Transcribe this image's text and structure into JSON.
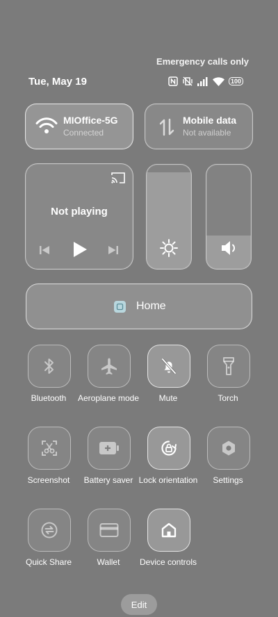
{
  "status_bar": {
    "emergency_text": "Emergency calls only",
    "date": "Tue, May 19",
    "battery_level": "100",
    "icons": [
      "nfc-icon",
      "vibrate-off-icon",
      "signal-icon",
      "wifi-icon",
      "battery-icon"
    ]
  },
  "wifi_tile": {
    "title": "MIOffice-5G",
    "subtitle": "Connected",
    "icon": "wifi-icon"
  },
  "mobile_tile": {
    "title": "Mobile data",
    "subtitle": "Not available",
    "icon": "data-arrows-icon"
  },
  "media": {
    "status": "Not playing",
    "controls": [
      "previous-icon",
      "play-icon",
      "next-icon"
    ],
    "cast_icon": "cast-icon"
  },
  "sliders": {
    "brightness": {
      "icon": "sun-icon",
      "level": 0.93
    },
    "volume": {
      "icon": "speaker-icon",
      "level": 0.32
    }
  },
  "home_tile": {
    "label": "Home",
    "icon": "home-app-icon"
  },
  "toggles": [
    {
      "label": "Bluetooth",
      "icon": "bluetooth-icon",
      "on": false
    },
    {
      "label": "Aeroplane mode",
      "icon": "airplane-icon",
      "on": false
    },
    {
      "label": "Mute",
      "icon": "bell-off-icon",
      "on": true
    },
    {
      "label": "Torch",
      "icon": "flashlight-icon",
      "on": false
    },
    {
      "label": "Screenshot",
      "icon": "scissors-icon",
      "on": false
    },
    {
      "label": "Battery saver",
      "icon": "battery-plus-icon",
      "on": false
    },
    {
      "label": "Lock orientation",
      "icon": "rotation-lock-icon",
      "on": true
    },
    {
      "label": "Settings",
      "icon": "gear-icon",
      "on": false
    },
    {
      "label": "Quick Share",
      "icon": "quick-share-icon",
      "on": false
    },
    {
      "label": "Wallet",
      "icon": "wallet-icon",
      "on": false
    },
    {
      "label": "Device controls",
      "icon": "home-icon",
      "on": true
    }
  ],
  "edit_label": "Edit"
}
